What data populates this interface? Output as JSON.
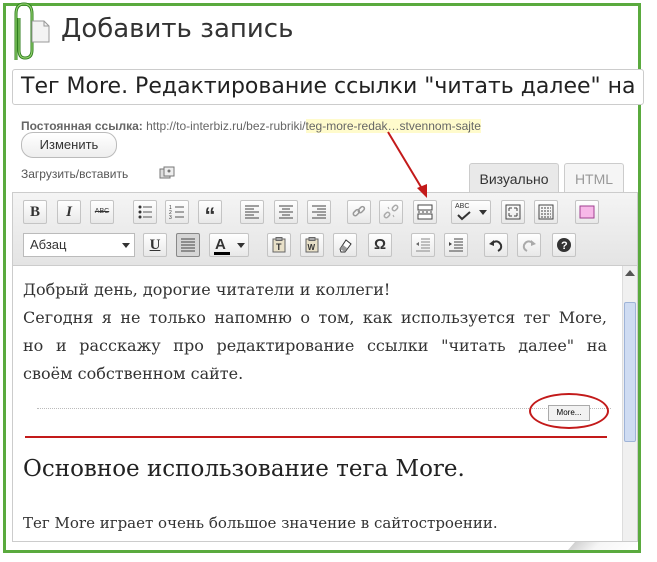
{
  "page": {
    "heading": "Добавить запись"
  },
  "post": {
    "title": "Тег More. Редактирование ссылки \"читать далее\" на св",
    "permalink_label": "Постоянная ссылка:",
    "permalink_base": "http://to-interbiz.ru/bez-rubriki/",
    "permalink_slug": "teg-more-redak…stvennom-sajte",
    "change_button": "Изменить"
  },
  "media": {
    "upload_label": "Загрузить/вставить",
    "icon": "media-icon"
  },
  "tabs": [
    {
      "label": "Визуально",
      "active": true
    },
    {
      "label": "HTML",
      "active": false
    }
  ],
  "toolbar": {
    "row1": [
      {
        "name": "bold-button",
        "icon": "bold-icon",
        "text": "B"
      },
      {
        "name": "italic-button",
        "icon": "italic-icon",
        "text": "I"
      },
      {
        "name": "strikethrough-button",
        "icon": "strikethrough-icon",
        "text": "ABC"
      },
      {
        "name": "bullet-list-button",
        "icon": "bullet-list-icon"
      },
      {
        "name": "numbered-list-button",
        "icon": "numbered-list-icon"
      },
      {
        "name": "blockquote-button",
        "icon": "blockquote-icon",
        "text": "“"
      },
      {
        "name": "align-left-button",
        "icon": "align-left-icon"
      },
      {
        "name": "align-center-button",
        "icon": "align-center-icon"
      },
      {
        "name": "align-right-button",
        "icon": "align-right-icon"
      },
      {
        "name": "insert-link-button",
        "icon": "link-icon"
      },
      {
        "name": "unlink-button",
        "icon": "unlink-icon"
      },
      {
        "name": "insert-more-button",
        "icon": "more-tag-icon"
      },
      {
        "name": "spellcheck-button",
        "icon": "spellcheck-icon",
        "text": "ABC"
      },
      {
        "name": "fullscreen-button",
        "icon": "fullscreen-icon"
      },
      {
        "name": "kitchen-sink-button",
        "icon": "kitchen-sink-icon"
      },
      {
        "name": "pink-box-button",
        "icon": "pink-box-icon"
      }
    ],
    "format_select": "Абзац",
    "row2": [
      {
        "name": "underline-button",
        "icon": "underline-icon",
        "text": "U"
      },
      {
        "name": "justify-button",
        "icon": "justify-icon"
      },
      {
        "name": "text-color-button",
        "icon": "text-color-icon",
        "text": "A"
      },
      {
        "name": "paste-text-button",
        "icon": "paste-text-icon"
      },
      {
        "name": "paste-word-button",
        "icon": "paste-word-icon"
      },
      {
        "name": "clear-format-button",
        "icon": "eraser-icon"
      },
      {
        "name": "special-char-button",
        "icon": "omega-icon",
        "text": "Ω"
      },
      {
        "name": "outdent-button",
        "icon": "outdent-icon"
      },
      {
        "name": "indent-button",
        "icon": "indent-icon"
      },
      {
        "name": "undo-button",
        "icon": "undo-icon"
      },
      {
        "name": "redo-button",
        "icon": "redo-icon"
      },
      {
        "name": "help-button",
        "icon": "help-icon"
      }
    ]
  },
  "content": {
    "line1": "Добрый день, дорогие читатели и коллеги!",
    "line2": "Сегодня я не только напомню о том, как используется тег More,",
    "line3": "но и расскажу про редактирование ссылки \"читать далее\" на",
    "line4": "своём собственном сайте.",
    "more_tag": "More...",
    "heading": "Основное использование тега More.",
    "line5": "Тег More играет очень большое значение в сайтостроении."
  },
  "colors": {
    "frame": "#5aaa3e",
    "annotation": "#c31a1a",
    "slug_highlight": "#fffbcc"
  }
}
